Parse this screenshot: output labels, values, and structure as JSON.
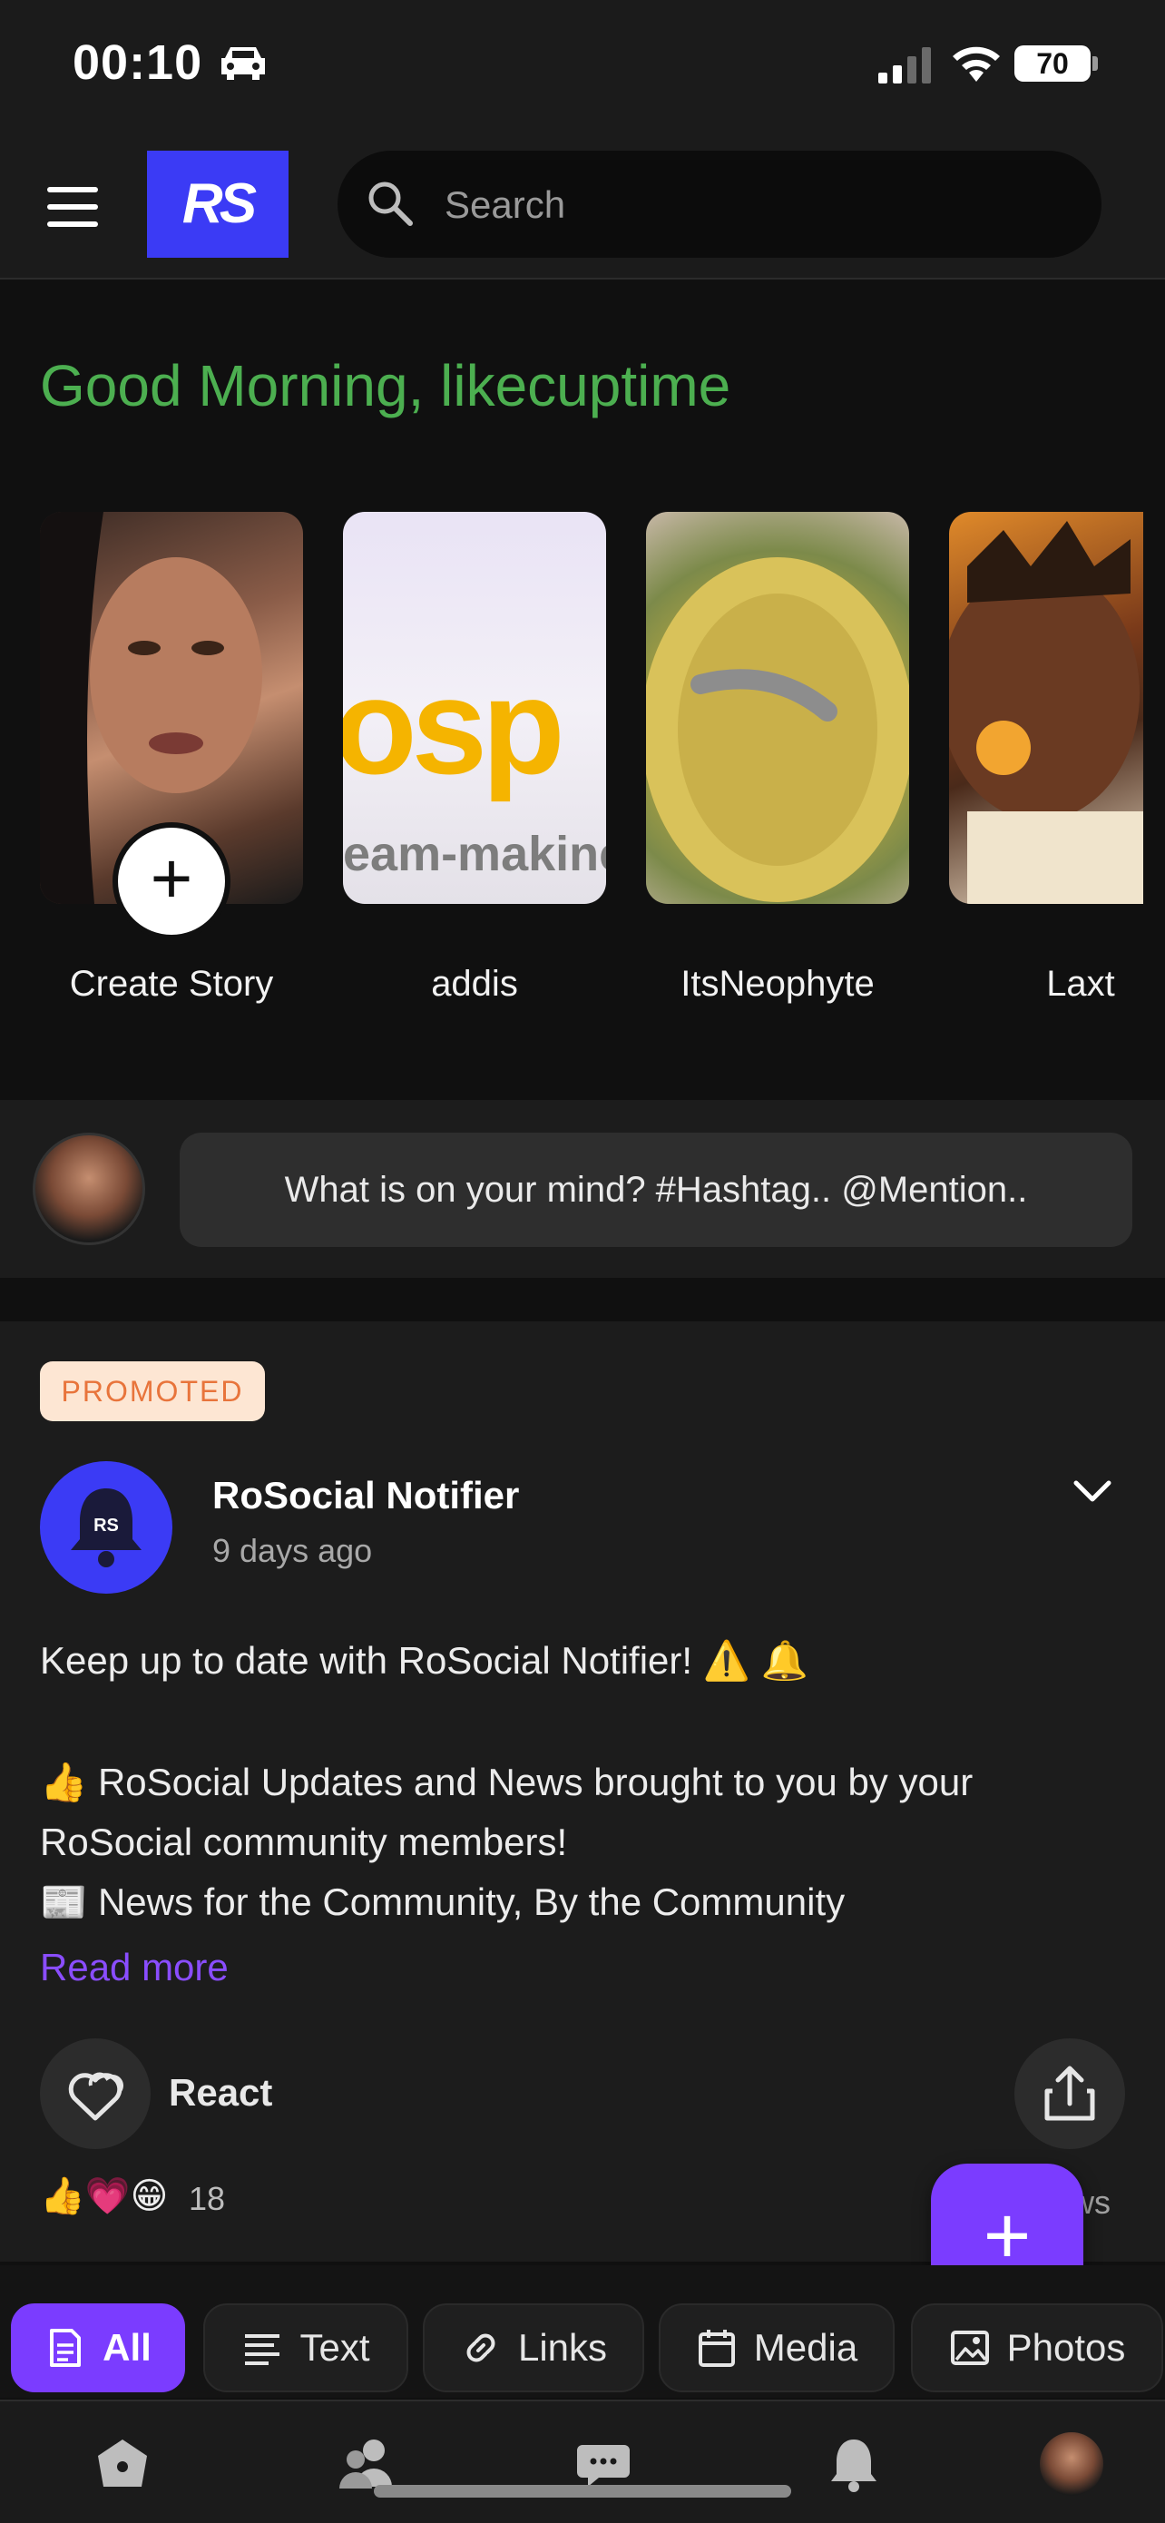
{
  "status_bar": {
    "time": "00:10",
    "battery": "70"
  },
  "header": {
    "logo": "RS",
    "search_placeholder": "Search"
  },
  "greeting": "Good Morning, likecuptime",
  "stories": [
    {
      "label": "Create Story"
    },
    {
      "label": "addis",
      "thumb_text": "osp",
      "thumb_sub": "eam-makinc"
    },
    {
      "label": "ItsNeophyte"
    },
    {
      "label": "Laxt"
    }
  ],
  "composer": {
    "placeholder": "What is on your mind? #Hashtag.. @Mention.."
  },
  "post": {
    "badge": "PROMOTED",
    "author": "RoSocial Notifier",
    "time": "9 days ago",
    "avatar_text": "RS",
    "body": [
      "Keep up to date with RoSocial Notifier! ⚠️ 🔔",
      "👍 RoSocial Updates and News brought to you by your",
      "RoSocial community members!",
      "📰 News for the Community, By the Community"
    ],
    "read_more": "Read more",
    "react_label": "React",
    "reaction_emojis": "👍💗😁",
    "reaction_count": "18",
    "views_fragment": "ws"
  },
  "filters": [
    {
      "label": "All",
      "active": true
    },
    {
      "label": "Text"
    },
    {
      "label": "Links"
    },
    {
      "label": "Media"
    },
    {
      "label": "Photos"
    }
  ],
  "colors": {
    "accent": "#7b3cff",
    "logo_bg": "#3b3bf5",
    "greeting": "#4caf50",
    "badge_bg": "#fde6d3",
    "badge_text": "#e8743b"
  },
  "icons": {
    "nav": [
      "home-icon",
      "people-icon",
      "chat-icon",
      "bell-icon",
      "profile-avatar"
    ]
  }
}
